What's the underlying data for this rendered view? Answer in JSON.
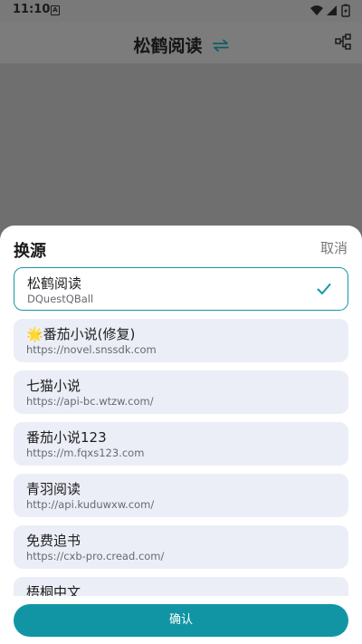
{
  "status_bar": {
    "time": "11:10",
    "notification_glyph": "A",
    "icons": [
      "wifi-icon",
      "signal-icon",
      "battery-icon"
    ]
  },
  "app_bar": {
    "title": "松鹤阅读",
    "swap_icon": "swap-arrows-icon",
    "share_icon": "share-icon"
  },
  "sheet": {
    "title": "换源",
    "cancel_label": "取消",
    "confirm_label": "确认",
    "sources": [
      {
        "name": "松鹤阅读",
        "url": "DQuestQBall",
        "selected": true
      },
      {
        "name": "🌟番茄小说(修复)",
        "url": "https://novel.snssdk.com",
        "selected": false
      },
      {
        "name": "七猫小说",
        "url": "https://api-bc.wtzw.com/",
        "selected": false
      },
      {
        "name": "番茄小说123",
        "url": "https://m.fqxs123.com",
        "selected": false
      },
      {
        "name": "青羽阅读",
        "url": "http://api.kuduwxw.com/",
        "selected": false
      },
      {
        "name": "免费追书",
        "url": "https://cxb-pro.cread.com/",
        "selected": false
      },
      {
        "name": "梧桐中文",
        "url": "",
        "selected": false
      }
    ]
  },
  "colors": {
    "accent": "#1195a4",
    "item_bg": "#eceef7",
    "scrim": "#6f6f6f"
  }
}
